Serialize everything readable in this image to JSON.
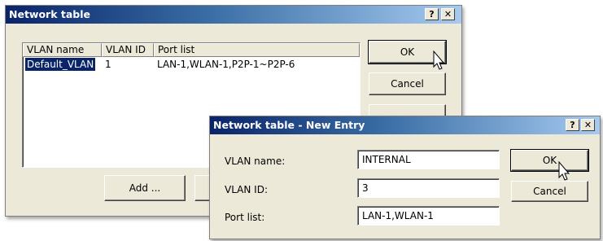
{
  "main_window": {
    "title": "Network table",
    "help_btn": "?",
    "close_btn": "✕",
    "columns": [
      "VLAN name",
      "VLAN ID",
      "Port list"
    ],
    "rows": [
      {
        "name": "Default_VLAN",
        "id": "1",
        "ports": "LAN-1,WLAN-1,P2P-1~P2P-6"
      }
    ],
    "ok_label": "OK",
    "cancel_label": "Cancel",
    "add_label": "Add ..."
  },
  "entry_dialog": {
    "title": "Network table - New Entry",
    "help_btn": "?",
    "close_btn": "✕",
    "vlan_name_label": "VLAN name:",
    "vlan_name_value": "INTERNAL",
    "vlan_id_label": "VLAN ID:",
    "vlan_id_value": "3",
    "port_list_label": "Port list:",
    "port_list_value": "LAN-1,WLAN-1",
    "ok_label": "OK",
    "cancel_label": "Cancel"
  },
  "colors": {
    "title_start": "#0a246a",
    "title_end": "#a6caf0",
    "face": "#ece9d8",
    "selection": "#0a246a"
  }
}
